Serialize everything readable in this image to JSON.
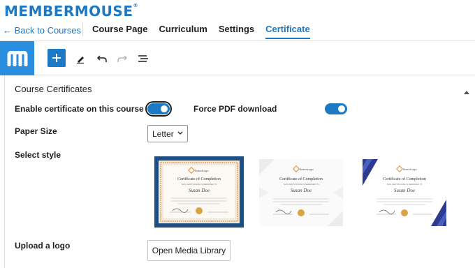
{
  "header": {
    "logo_text": "MEMBERMOUSE",
    "logo_mark": "®",
    "back_label": "← Back to Courses",
    "tabs": [
      {
        "label": "Course Page",
        "active": false
      },
      {
        "label": "Curriculum",
        "active": false
      },
      {
        "label": "Settings",
        "active": false
      },
      {
        "label": "Certificate",
        "active": true
      }
    ]
  },
  "toolbar": {
    "icons": [
      "m-logo-icon",
      "add-block-icon",
      "edit-pencil-icon",
      "undo-icon",
      "redo-icon",
      "list-view-icon"
    ]
  },
  "panel": {
    "title": "Course Certificates",
    "enable_label": "Enable certificate on this course",
    "enable_on": true,
    "force_pdf_label": "Force PDF download",
    "force_pdf_on": true,
    "paper_size_label": "Paper Size",
    "paper_size_value": "Letter",
    "select_style_label": "Select style",
    "styles": [
      {
        "selected": true,
        "brand": "BrandLogo",
        "heading": "Certificate of Completion",
        "sub": "THIS CERTIFICATE IS AWARDED TO",
        "name": "Susan Doe"
      },
      {
        "selected": false,
        "brand": "BrandLogo",
        "heading": "Certificate of Completion",
        "sub": "THIS CERTIFICATE IS AWARDED TO",
        "name": "Susan Doe"
      },
      {
        "selected": false,
        "brand": "BrandLogo",
        "heading": "Certificate of Completion",
        "sub": "THIS CERTIFICATE IS AWARDED TO",
        "name": "Susan Doe"
      }
    ],
    "upload_logo_label": "Upload a logo",
    "media_button": "Open Media Library"
  },
  "colors": {
    "accent": "#1b79c6",
    "selected_border": "#1d4f86",
    "gold": "#d9a441",
    "navy": "#2c3a8f"
  }
}
